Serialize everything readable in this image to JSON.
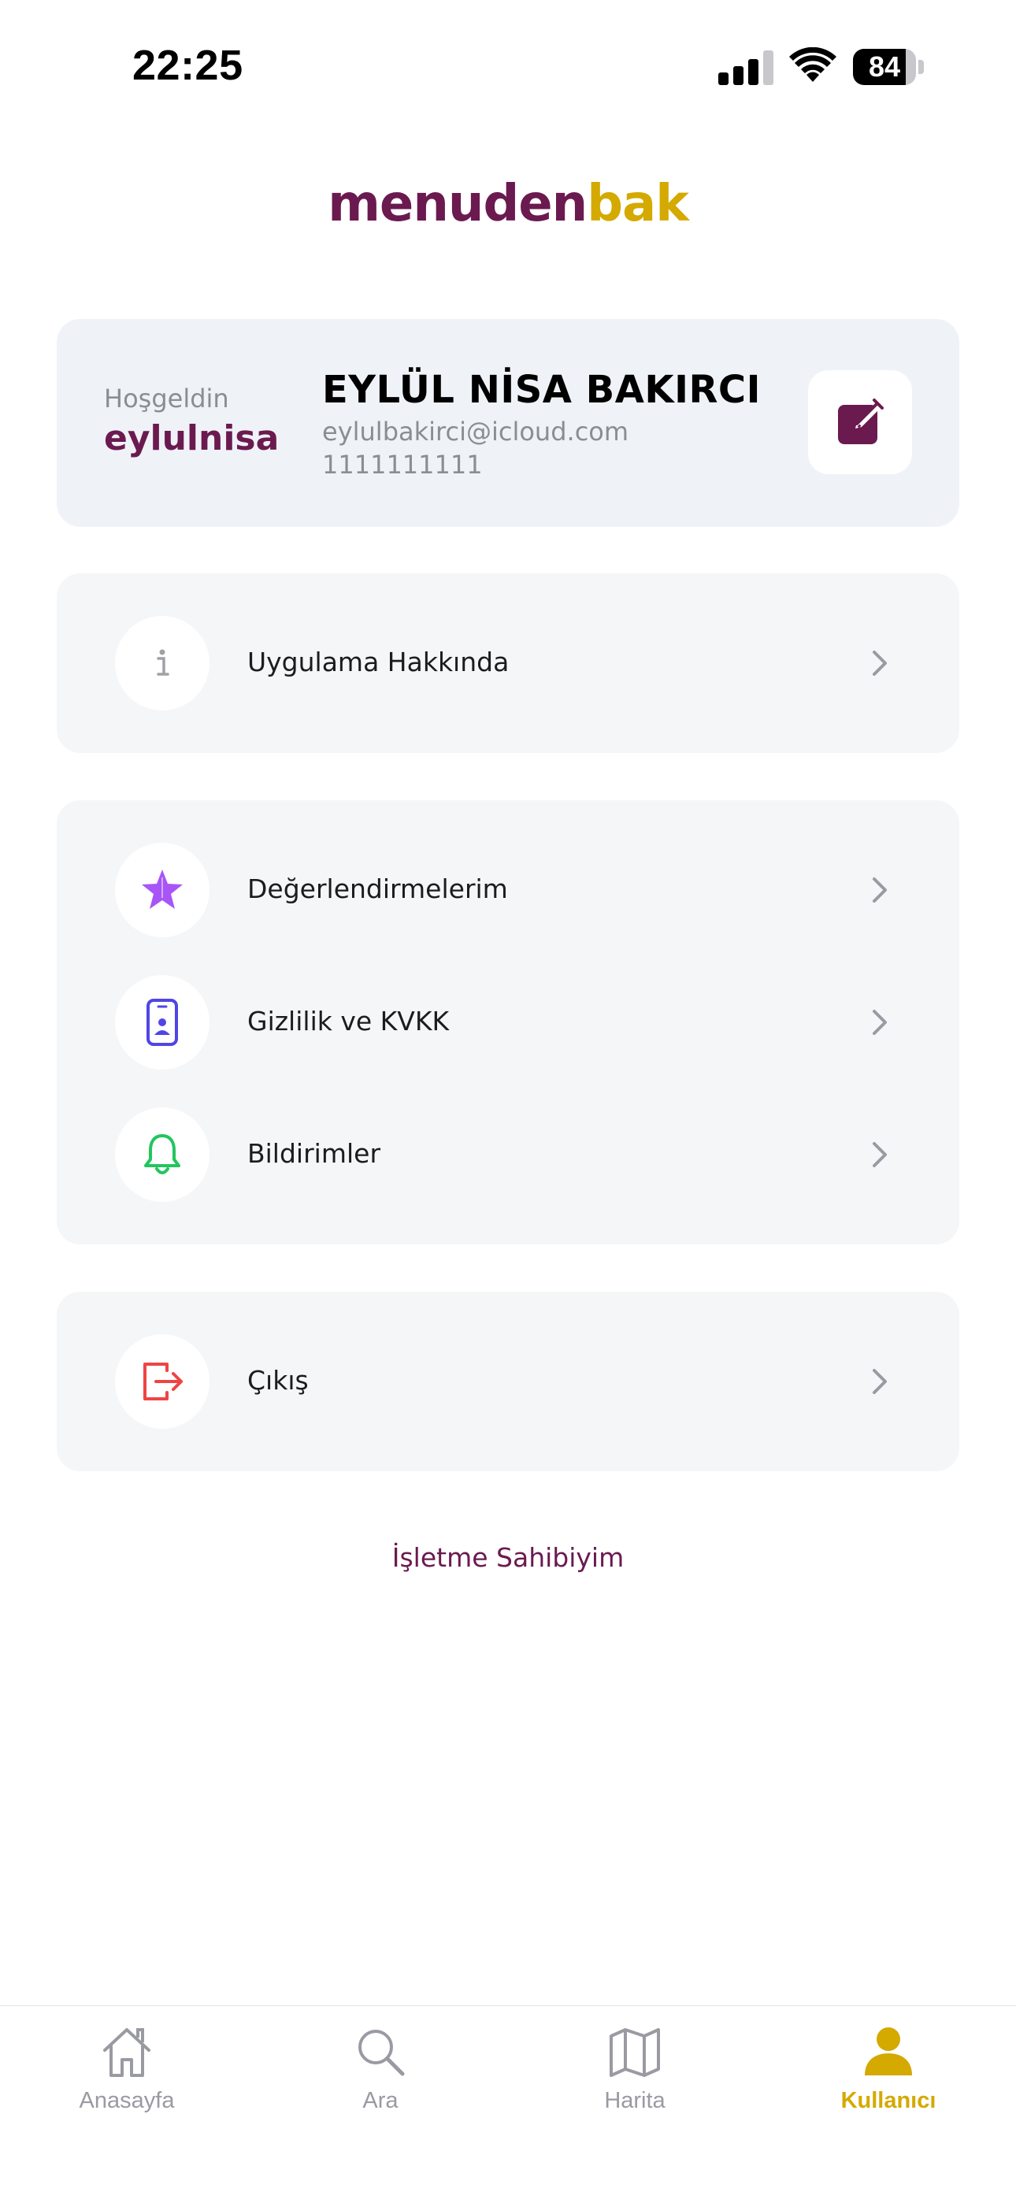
{
  "status_bar": {
    "time": "22:25",
    "battery_level": "84"
  },
  "header": {
    "logo_part1": "menuden",
    "logo_part2": "bak"
  },
  "profile": {
    "greeting": "Hoşgeldin",
    "username": "eylulnisa",
    "full_name": "EYLÜL NİSA BAKIRCI",
    "email": "eylulbakirci@icloud.com",
    "phone": "1111111111"
  },
  "menu": {
    "about": {
      "label": "Uygulama Hakkında",
      "icon": "info-icon"
    },
    "reviews": {
      "label": "Değerlendirmelerim",
      "icon": "star-icon",
      "color": "#a855f7"
    },
    "privacy": {
      "label": "Gizlilik ve KVKK",
      "icon": "phone-user-icon",
      "color": "#4f46e5"
    },
    "notifications": {
      "label": "Bildirimler",
      "icon": "bell-icon",
      "color": "#22c55e"
    },
    "logout": {
      "label": "Çıkış",
      "icon": "logout-icon",
      "color": "#ef4444"
    }
  },
  "owner_link": "İşletme Sahibiyim",
  "tabbar": {
    "home": "Anasayfa",
    "search": "Ara",
    "map": "Harita",
    "user": "Kullanıcı",
    "active": "user",
    "active_color": "#d4a900",
    "inactive_color": "#9a9aa3"
  }
}
